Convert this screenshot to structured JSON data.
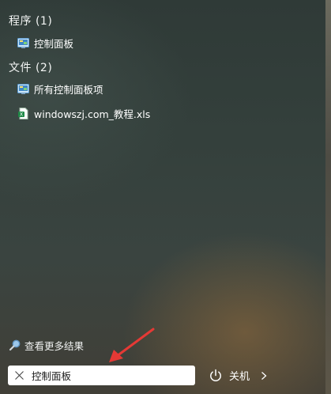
{
  "results": {
    "programs_header": "程序 (1)",
    "programs": [
      {
        "label": "控制面板",
        "icon": "control-panel-icon"
      }
    ],
    "files_header": "文件 (2)",
    "files": [
      {
        "label": "所有控制面板项",
        "icon": "control-panel-icon"
      },
      {
        "label": "windowszj.com_教程.xls",
        "icon": "excel-file-icon"
      }
    ]
  },
  "see_more": {
    "label": "查看更多结果",
    "icon": "search-icon"
  },
  "search": {
    "value": "控制面板",
    "clear_icon": "close-icon"
  },
  "power": {
    "label": "关机",
    "icon": "power-icon",
    "chevron_icon": "chevron-right-icon"
  },
  "annotation": {
    "color": "#e53935"
  }
}
